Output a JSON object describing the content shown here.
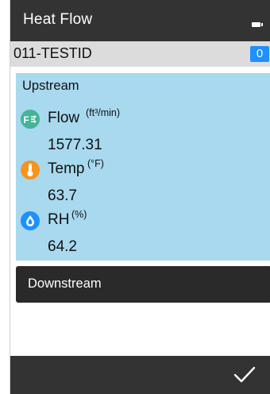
{
  "header": {
    "title": "Heat Flow",
    "battery_icon": "battery-icon"
  },
  "device": {
    "id": "011-TESTID",
    "badge": "0"
  },
  "upstream": {
    "title": "Upstream",
    "measurements": [
      {
        "icon": "flow-icon",
        "label": "Flow",
        "unit": "(ft³/min)",
        "value": "1577.31",
        "color": "#45b398"
      },
      {
        "icon": "thermometer-icon",
        "label": "Temp",
        "unit": "(°F)",
        "value": "63.7",
        "color": "#f7941d"
      },
      {
        "icon": "droplet-icon",
        "label": "RH",
        "unit": "(%)",
        "value": "64.2",
        "color": "#1e90ff"
      }
    ]
  },
  "downstream": {
    "title": "Downstream"
  },
  "footer": {
    "confirm_icon": "checkmark-icon"
  },
  "colors": {
    "titlebar": "#333333",
    "upstream_panel": "#a8d9ee",
    "downstream_panel": "#2a2a2a",
    "badge": "#1e90ff"
  }
}
